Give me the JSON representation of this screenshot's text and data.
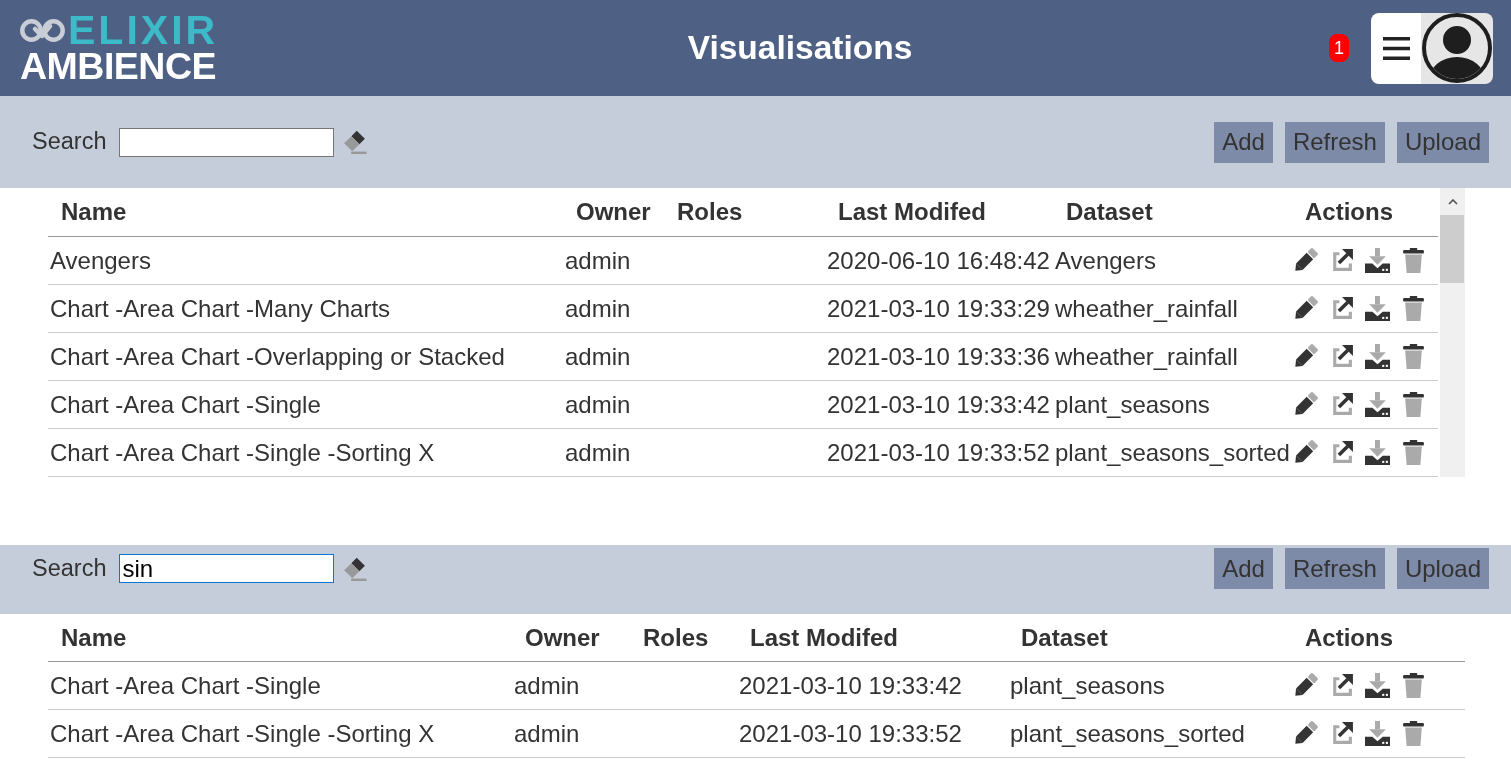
{
  "header": {
    "logo": {
      "line_1": "ELIXIR",
      "line_2": "AMBIENCE"
    },
    "title": "Visualisations",
    "notification_count": "1"
  },
  "panels": [
    {
      "search": {
        "label": "Search",
        "focused": false
      },
      "buttons": [
        "Add",
        "Refresh",
        "Upload"
      ],
      "table": {
        "scrollable": true,
        "columns": [
          "Name",
          "Owner",
          "Roles",
          "Last Modifed",
          "Dataset",
          "Actions"
        ],
        "rows": [
          {
            "name": "Avengers",
            "owner": "admin",
            "last_modified": "2020-06-10 16:48:42",
            "dataset": "Avengers"
          },
          {
            "name": "Chart -Area Chart -Many Charts",
            "owner": "admin",
            "last_modified": "2021-03-10 19:33:29",
            "dataset": "wheather_rainfall"
          },
          {
            "name": "Chart -Area Chart -Overlapping or Stacked",
            "owner": "admin",
            "last_modified": "2021-03-10 19:33:36",
            "dataset": "wheather_rainfall"
          },
          {
            "name": "Chart -Area Chart -Single",
            "owner": "admin",
            "last_modified": "2021-03-10 19:33:42",
            "dataset": "plant_seasons"
          },
          {
            "name": "Chart -Area Chart -Single -Sorting X",
            "owner": "admin",
            "last_modified": "2021-03-10 19:33:52",
            "dataset": "plant_seasons_sorted"
          }
        ]
      }
    },
    {
      "search": {
        "label": "Search",
        "value": "sin",
        "focused": true
      },
      "buttons": [
        "Add",
        "Refresh",
        "Upload"
      ],
      "table": {
        "scrollable": false,
        "columns": [
          "Name",
          "Owner",
          "Roles",
          "Last Modifed",
          "Dataset",
          "Actions"
        ],
        "rows": [
          {
            "name": "Chart -Area Chart -Single",
            "owner": "admin",
            "last_modified": "2021-03-10 19:33:42",
            "dataset": "plant_seasons"
          },
          {
            "name": "Chart -Area Chart -Single -Sorting X",
            "owner": "admin",
            "last_modified": "2021-03-10 19:33:52",
            "dataset": "plant_seasons_sorted"
          }
        ]
      }
    }
  ]
}
